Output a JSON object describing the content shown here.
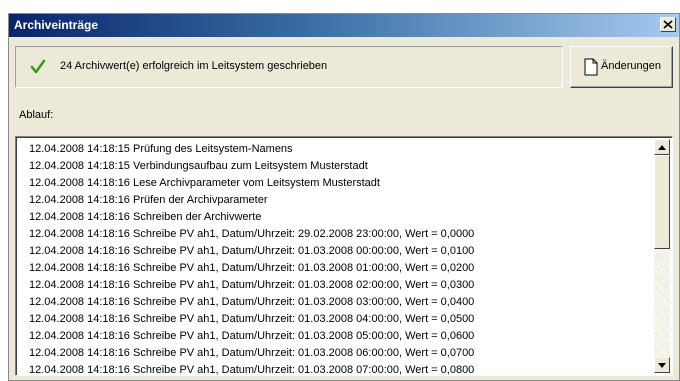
{
  "window": {
    "title": "Archiveinträge"
  },
  "status": {
    "message": "24 Archivwert(e) erfolgreich im Leitsystem geschrieben",
    "icon": "check-icon",
    "icon_color": "#3c9a1a"
  },
  "buttons": {
    "changes_label": "Änderungen",
    "close_label": "X"
  },
  "log": {
    "label": "Ablauf:",
    "lines": [
      "12.04.2008 14:18:15 Prüfung des Leitsystem-Namens",
      "12.04.2008 14:18:15 Verbindungsaufbau zum Leitsystem Musterstadt",
      "12.04.2008 14:18:16 Lese Archivparameter vom Leitsystem Musterstadt",
      "12.04.2008 14:18:16 Prüfen der Archivparameter",
      "12.04.2008 14:18:16 Schreiben der Archivwerte",
      "12.04.2008 14:18:16 Schreibe PV ah1, Datum/Uhrzeit: 29.02.2008 23:00:00, Wert = 0,0000",
      "12.04.2008 14:18:16 Schreibe PV ah1, Datum/Uhrzeit: 01.03.2008 00:00:00, Wert = 0,0100",
      "12.04.2008 14:18:16 Schreibe PV ah1, Datum/Uhrzeit: 01.03.2008 01:00:00, Wert = 0,0200",
      "12.04.2008 14:18:16 Schreibe PV ah1, Datum/Uhrzeit: 01.03.2008 02:00:00, Wert = 0,0300",
      "12.04.2008 14:18:16 Schreibe PV ah1, Datum/Uhrzeit: 01.03.2008 03:00:00, Wert = 0,0400",
      "12.04.2008 14:18:16 Schreibe PV ah1, Datum/Uhrzeit: 01.03.2008 04:00:00, Wert = 0,0500",
      "12.04.2008 14:18:16 Schreibe PV ah1, Datum/Uhrzeit: 01.03.2008 05:00:00, Wert = 0,0600",
      "12.04.2008 14:18:16 Schreibe PV ah1, Datum/Uhrzeit: 01.03.2008 06:00:00, Wert = 0,0700",
      "12.04.2008 14:18:16 Schreibe PV ah1, Datum/Uhrzeit: 01.03.2008 07:00:00, Wert = 0,0800"
    ]
  },
  "colors": {
    "titlebar_start": "#0a246a",
    "titlebar_end": "#a6caf0",
    "dialog_background": "#ece9d8"
  }
}
